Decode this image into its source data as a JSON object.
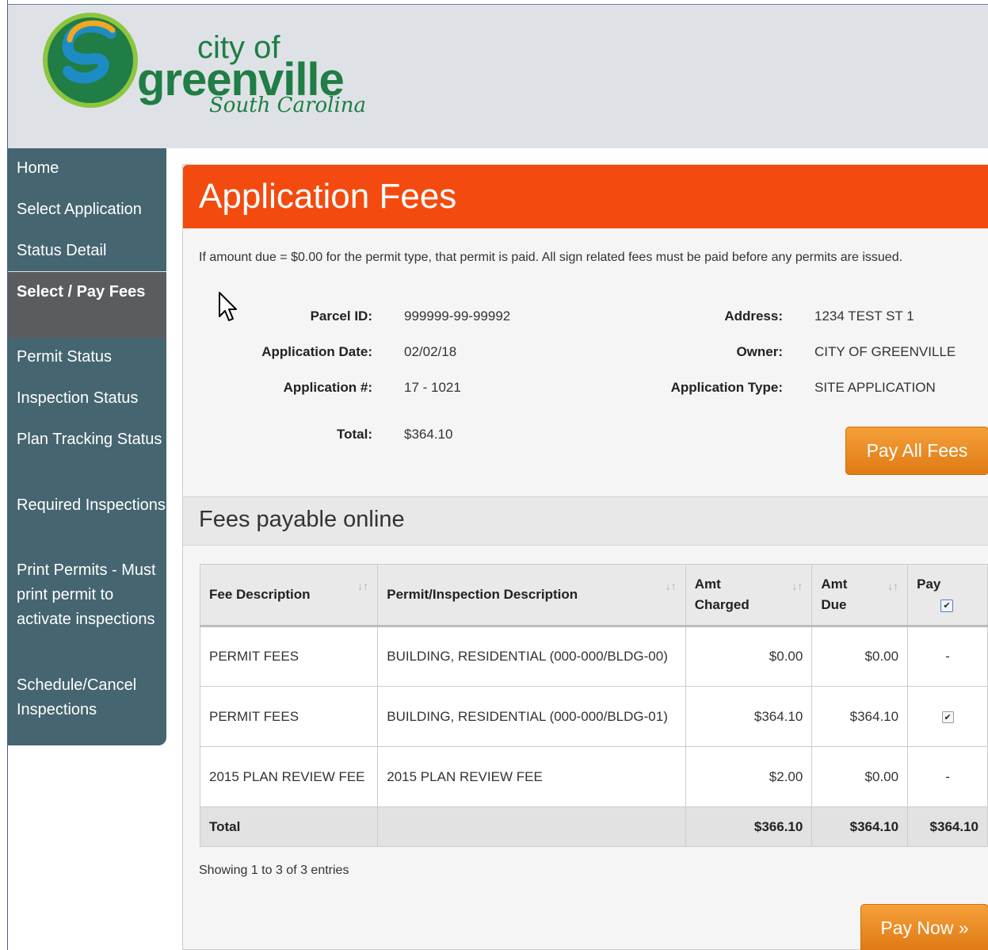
{
  "header": {
    "logo": {
      "line1": "city of",
      "line2": "greenville",
      "line3": "South Carolina",
      "colors": {
        "green": "#1f7d45",
        "blue": "#1d8cc4"
      }
    }
  },
  "sidebar": {
    "items": [
      {
        "label": "Home"
      },
      {
        "label": "Select Application"
      },
      {
        "label": "Status Detail"
      },
      {
        "label": "Select / Pay Fees",
        "active": true
      },
      {
        "label": "Permit Status"
      },
      {
        "label": "Inspection Status"
      },
      {
        "label": "Plan Tracking Status"
      },
      {
        "label": "Required Inspections"
      },
      {
        "label": "Print Permits - Must print permit to activate inspections"
      },
      {
        "label": "Schedule/Cancel Inspections"
      }
    ]
  },
  "panel": {
    "title": "Application Fees",
    "notice": "If amount due = $0.00 for the permit type, that permit is paid. All sign related fees must be paid before any permits are issued.",
    "info": {
      "parcel_id_label": "Parcel ID:",
      "parcel_id": "999999-99-99992",
      "app_date_label": "Application Date:",
      "app_date": "02/02/18",
      "app_num_label": "Application #:",
      "app_num": "17 - 1021",
      "total_label": "Total:",
      "total": "$364.10",
      "address_label": "Address:",
      "address": "1234 TEST ST 1",
      "owner_label": "Owner:",
      "owner": "CITY OF GREENVILLE",
      "app_type_label": "Application Type:",
      "app_type": "SITE APPLICATION"
    },
    "pay_all_label": "Pay All Fees",
    "section_title": "Fees payable online",
    "table": {
      "headers": [
        "Fee Description",
        "Permit/Inspection Description",
        "Amt Charged",
        "Amt Due",
        "Pay"
      ],
      "rows": [
        {
          "fee": "PERMIT FEES",
          "permit": "BUILDING, RESIDENTIAL (000-000/BLDG-00)",
          "charged": "$0.00",
          "due": "$0.00",
          "pay": "-"
        },
        {
          "fee": "PERMIT FEES",
          "permit": "BUILDING, RESIDENTIAL (000-000/BLDG-01)",
          "charged": "$364.10",
          "due": "$364.10",
          "pay": "checked"
        },
        {
          "fee": "2015 PLAN REVIEW FEE",
          "permit": "2015 PLAN REVIEW FEE",
          "charged": "$2.00",
          "due": "$0.00",
          "pay": "-"
        }
      ],
      "total": {
        "label": "Total",
        "charged": "$366.10",
        "due": "$364.10",
        "pay": "$364.10"
      }
    },
    "showing": "Showing 1 to 3 of 3 entries",
    "pay_now_label": "Pay Now »"
  },
  "colors": {
    "accent": "#f34b0f",
    "nav_bg": "#456570",
    "button": "#e8861f"
  }
}
